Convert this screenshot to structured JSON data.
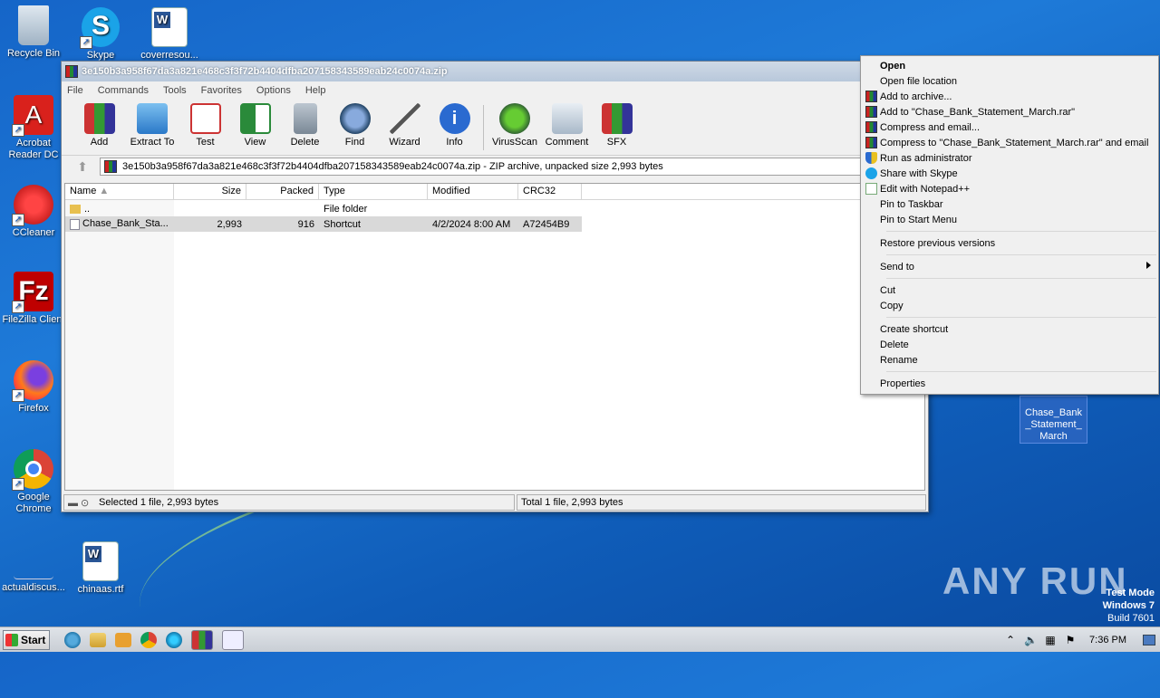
{
  "desktop": {
    "icons": [
      {
        "label": "Recycle Bin"
      },
      {
        "label": "Skype"
      },
      {
        "label": "coverresou..."
      },
      {
        "label": "Acrobat Reader DC"
      },
      {
        "label": "CCleaner"
      },
      {
        "label": "FileZilla Client"
      },
      {
        "label": "Firefox"
      },
      {
        "label": "Google Chrome"
      },
      {
        "label": "actualdiscus..."
      },
      {
        "label": "chinaas.rtf"
      }
    ],
    "selected_file": "Chase_Bank_Statement_March"
  },
  "winrar": {
    "title": "3e150b3a958f67da3a821e468c3f3f72b4404dfba207158343589eab24c0074a.zip",
    "menu": [
      "File",
      "Commands",
      "Tools",
      "Favorites",
      "Options",
      "Help"
    ],
    "toolbar": [
      "Add",
      "Extract To",
      "Test",
      "View",
      "Delete",
      "Find",
      "Wizard",
      "Info",
      "VirusScan",
      "Comment",
      "SFX"
    ],
    "address": "3e150b3a958f67da3a821e468c3f3f72b4404dfba207158343589eab24c0074a.zip - ZIP archive, unpacked size 2,993 bytes",
    "columns": [
      "Name",
      "Size",
      "Packed",
      "Type",
      "Modified",
      "CRC32"
    ],
    "rows": [
      {
        "name": "..",
        "size": "",
        "packed": "",
        "type": "File folder",
        "modified": "",
        "crc": ""
      },
      {
        "name": "Chase_Bank_Sta...",
        "size": "2,993",
        "packed": "916",
        "type": "Shortcut",
        "modified": "4/2/2024 8:00 AM",
        "crc": "A72454B9"
      }
    ],
    "status_left": "Selected 1 file, 2,993 bytes",
    "status_right": "Total 1 file, 2,993 bytes"
  },
  "context_menu": {
    "items": [
      "Open",
      "Open file location",
      "Add to archive...",
      "Add to \"Chase_Bank_Statement_March.rar\"",
      "Compress and email...",
      "Compress to \"Chase_Bank_Statement_March.rar\" and email",
      "Run as administrator",
      "Share with Skype",
      "Edit with Notepad++",
      "Pin to Taskbar",
      "Pin to Start Menu",
      "Restore previous versions",
      "Send to",
      "Cut",
      "Copy",
      "Create shortcut",
      "Delete",
      "Rename",
      "Properties"
    ]
  },
  "watermark": "ANY RUN",
  "test_mode": {
    "line1": "Test Mode",
    "line2": "Windows 7",
    "line3": "Build 7601"
  },
  "taskbar": {
    "start": "Start",
    "clock": "7:36 PM"
  }
}
